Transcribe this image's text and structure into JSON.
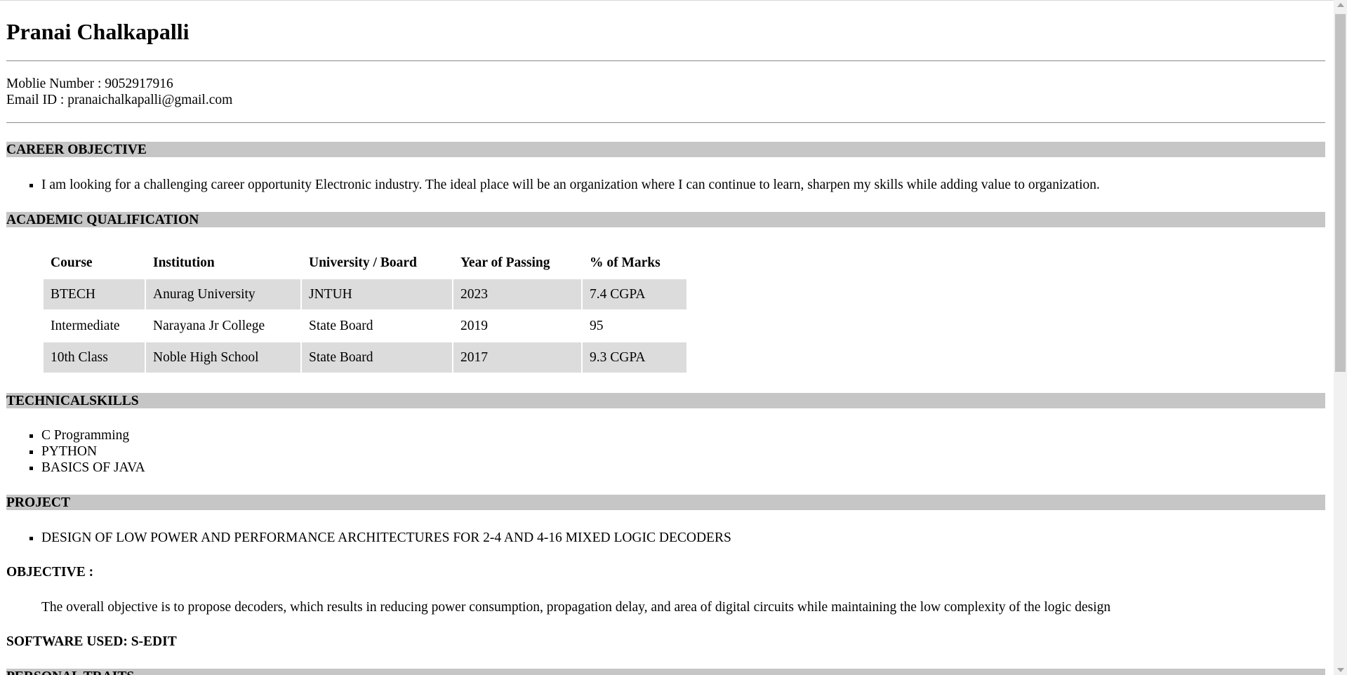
{
  "header": {
    "name": "Pranai Chalkapalli",
    "mobile": "Moblie Number : 9052917916",
    "email": "Email ID : pranaichalkapalli@gmail.com"
  },
  "sections": {
    "career_objective": {
      "title": "CAREER OBJECTIVE",
      "items": [
        "I am looking for a challenging career opportunity Electronic industry. The ideal place will be an organization where I can continue to learn, sharpen my skills while adding value to organization."
      ]
    },
    "academic": {
      "title": "ACADEMIC QUALIFICATION",
      "columns": [
        "Course",
        "Institution",
        "University / Board",
        "Year of Passing",
        "% of Marks"
      ],
      "rows": [
        [
          "BTECH",
          "Anurag University",
          "JNTUH",
          "2023",
          "7.4 CGPA"
        ],
        [
          "Intermediate",
          "Narayana Jr College",
          "State Board",
          "2019",
          "95"
        ],
        [
          "10th Class",
          "Noble High School",
          "State Board",
          "2017",
          "9.3 CGPA"
        ]
      ]
    },
    "technical_skills": {
      "title": "TECHNICALSKILLS",
      "items": [
        "C Programming",
        "PYTHON",
        "BASICS OF JAVA"
      ]
    },
    "project": {
      "title": "PROJECT",
      "items": [
        "DESIGN OF LOW POWER AND PERFORMANCE ARCHITECTURES FOR 2-4 AND 4-16 MIXED LOGIC DECODERS"
      ],
      "objective_label": "OBJECTIVE :",
      "objective_text": "The overall objective is to propose decoders, which results in reducing power consumption, propagation delay, and area of digital circuits while maintaining the low complexity of the logic design",
      "software_used": "SOFTWARE USED: S-EDIT"
    },
    "personal_traits": {
      "title": "PERSONAL TRAITS"
    }
  },
  "colors": {
    "section_bar": "#c6c6c6",
    "table_shade": "#dcdcdc"
  }
}
